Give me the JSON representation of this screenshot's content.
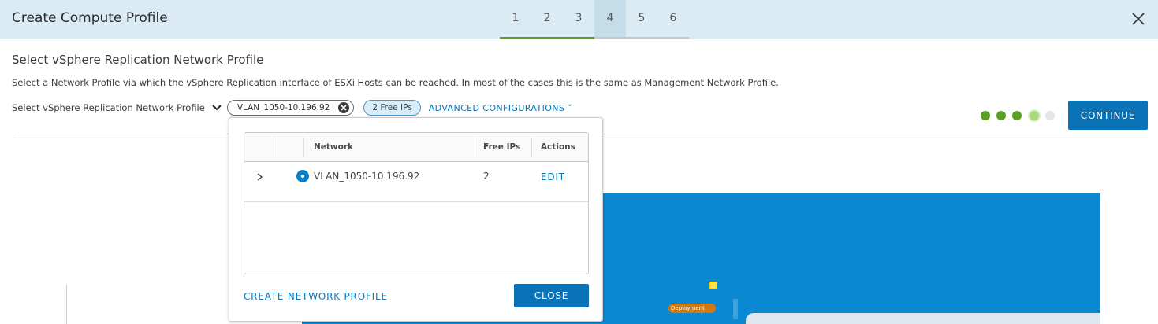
{
  "header": {
    "title": "Create Compute Profile",
    "steps": [
      "1",
      "2",
      "3",
      "4",
      "5",
      "6"
    ],
    "active_step": "4",
    "close_icon": "close-icon"
  },
  "main": {
    "section_title": "Select vSphere Replication Network Profile",
    "description": "Select a Network Profile via which the vSphere Replication interface of ESXi Hosts can be reached. In most of the cases this is the same as Management Network Profile.",
    "field_label": "Select vSphere Replication Network Profile",
    "selected_profile": "VLAN_1050-10.196.92",
    "free_ips_badge": "2 Free IPs",
    "advanced_label": "ADVANCED CONFIGURATIONS",
    "continue_label": "CONTINUE",
    "progress": {
      "completed": 3,
      "current": 4,
      "total": 5
    }
  },
  "dropdown": {
    "columns": [
      "Network",
      "Free IPs",
      "Actions"
    ],
    "rows": [
      {
        "network": "VLAN_1050-10.196.92",
        "free_ips": "2",
        "action": "EDIT",
        "selected": true
      }
    ],
    "create_label": "CREATE NETWORK PROFILE",
    "close_label": "CLOSE"
  },
  "background": {
    "deployment_tag": "Deployment"
  },
  "colors": {
    "header_bg": "#dbebf4",
    "accent_blue": "#0a73b8",
    "step_done_green": "#5aa220",
    "diagram_blue": "#0a88d2",
    "badge_bg": "#d9ecf8"
  }
}
